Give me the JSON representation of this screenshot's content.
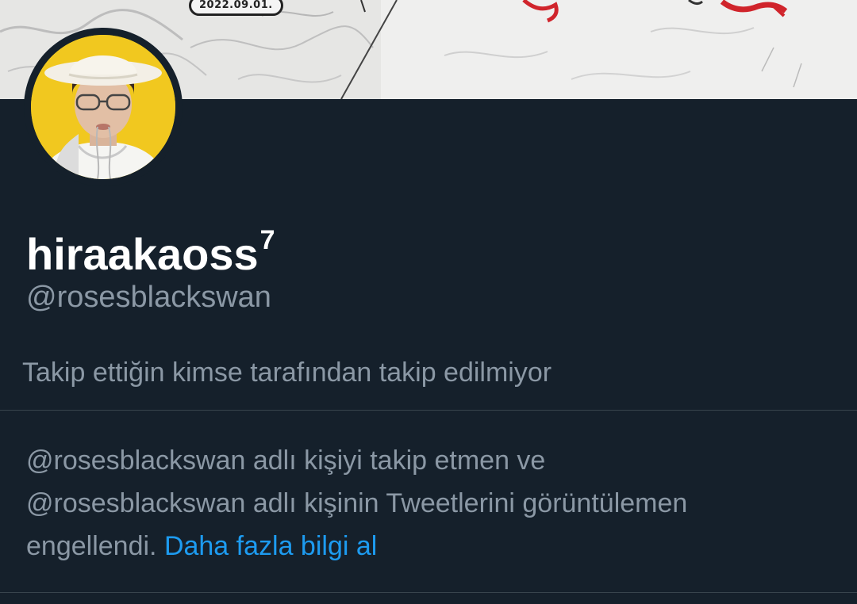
{
  "banner": {
    "date_text": "2022.09.01.",
    "accent_color": "#d0242b"
  },
  "profile": {
    "display_name": "hiraakaoss",
    "display_name_superscript": "7",
    "handle": "@rosesblackswan",
    "followers_you_know": "Takip ettiğin kimse tarafından takip edilmiyor"
  },
  "blocked_notice": {
    "line1": "@rosesblackswan adlı kişiyi takip etmen ve",
    "line2": "@rosesblackswan adlı kişinin Tweetlerini görüntülemen",
    "line3": "engellendi.",
    "learn_more_link": "Daha fazla bilgi al"
  },
  "colors": {
    "background": "#15202b",
    "primary_text": "#ffffff",
    "secondary_text": "#8b98a5",
    "link": "#1d9bf0",
    "divider": "#38444d"
  }
}
